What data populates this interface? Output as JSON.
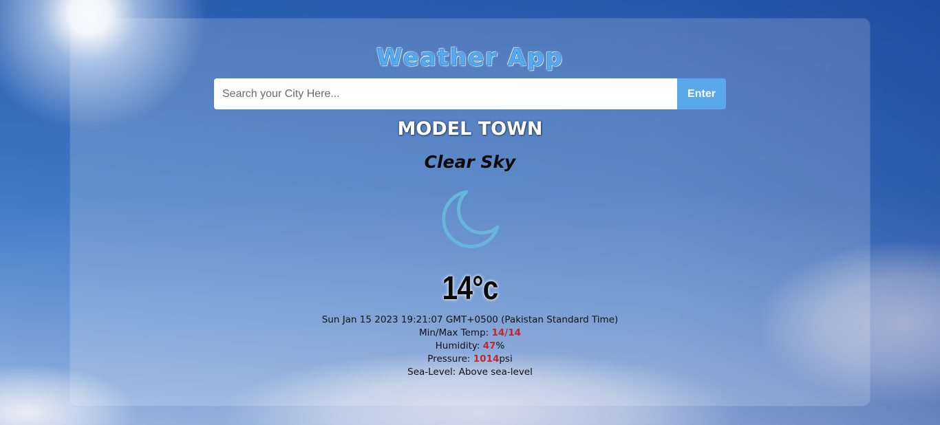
{
  "app": {
    "title": "Weather App"
  },
  "search": {
    "placeholder": "Search your City Here...",
    "value": "",
    "button_label": "Enter"
  },
  "weather": {
    "city": "MODEL TOWN",
    "condition": "Clear Sky",
    "icon": "moon-icon",
    "temperature": "14°c",
    "datetime": "Sun Jan 15 2023 19:21:07 GMT+0500 (Pakistan Standard Time)",
    "min_max_label": "Min/Max Temp: ",
    "min_max_value": "14/14",
    "humidity_label": "Humidity: ",
    "humidity_value": "47",
    "humidity_unit": "%",
    "pressure_label": "Pressure: ",
    "pressure_value": "1014",
    "pressure_unit": "psi",
    "sea_level_label": "Sea-Level: ",
    "sea_level_value": "Above sea-level"
  },
  "colors": {
    "accent": "#58a8ea",
    "value_highlight": "#c0262b",
    "icon": "#6ab4dc"
  }
}
